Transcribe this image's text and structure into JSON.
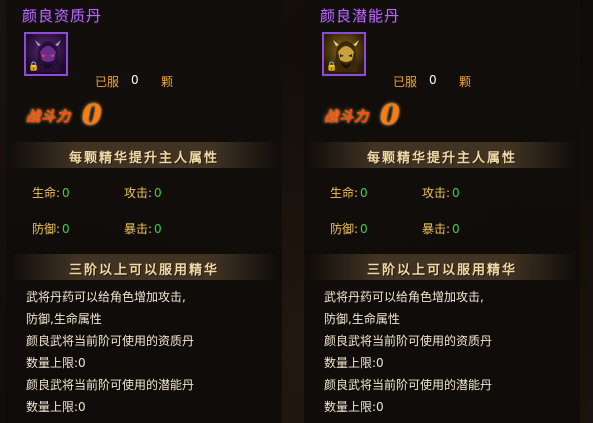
{
  "panels": [
    {
      "title": "颜良资质丹",
      "icon": "hero-portrait-purple-icon",
      "owned_label": "已服",
      "owned_count": "0",
      "owned_unit": "颗",
      "power_label": "战斗力",
      "power_value": "0",
      "section_attr": "每颗精华提升主人属性",
      "stats": {
        "hp_label": "生命:",
        "hp_value": "0",
        "atk_label": "攻击:",
        "atk_value": "0",
        "def_label": "防御:",
        "def_value": "0",
        "crit_label": "暴击:",
        "crit_value": "0"
      },
      "section_req": "三阶以上可以服用精华",
      "desc": [
        "武将丹药可以给角色增加攻击,",
        "防御,生命属性",
        "颜良武将当前阶可使用的资质丹",
        "数量上限:0",
        "颜良武将当前阶可使用的潜能丹",
        "数量上限:0"
      ]
    },
    {
      "title": "颜良潜能丹",
      "icon": "hero-portrait-gold-icon",
      "owned_label": "已服",
      "owned_count": "0",
      "owned_unit": "颗",
      "power_label": "战斗力",
      "power_value": "0",
      "section_attr": "每颗精华提升主人属性",
      "stats": {
        "hp_label": "生命:",
        "hp_value": "0",
        "atk_label": "攻击:",
        "atk_value": "0",
        "def_label": "防御:",
        "def_value": "0",
        "crit_label": "暴击:",
        "crit_value": "0"
      },
      "section_req": "三阶以上可以服用精华",
      "desc": [
        "武将丹药可以给角色增加攻击,",
        "防御,生命属性",
        "颜良武将当前阶可使用的资质丹",
        "数量上限:0",
        "颜良武将当前阶可使用的潜能丹",
        "数量上限:0"
      ]
    }
  ],
  "colors": {
    "title_purple": "#b56cf0",
    "label_orange": "#f2a42d",
    "value_green": "#3fd23f",
    "power_orange": "#ff7b0a"
  }
}
